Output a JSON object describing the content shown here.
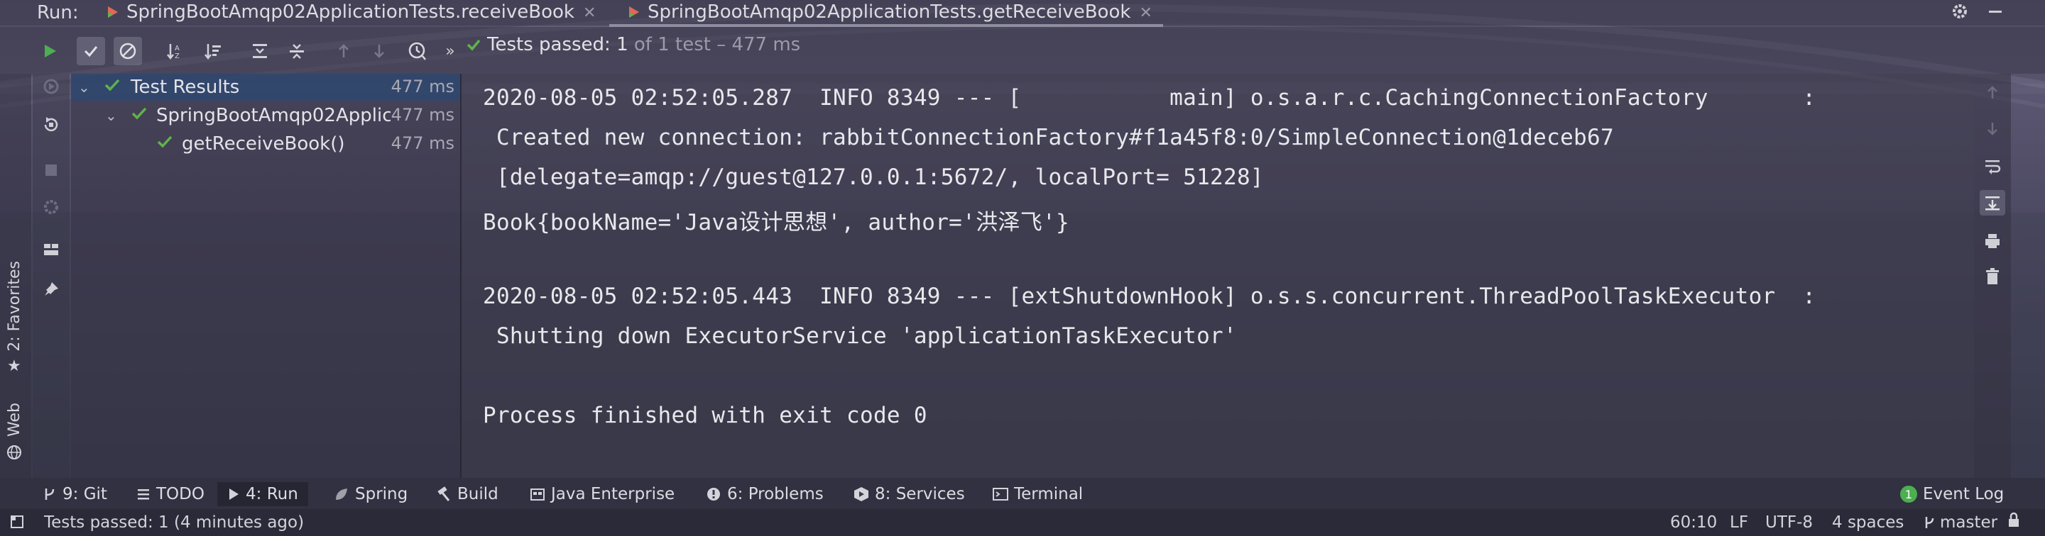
{
  "colors": {
    "accent_green": "#5fb34a",
    "run_green": "#4caf50",
    "selection": "#2f4870"
  },
  "run_bar": {
    "label": "Run:",
    "tabs": [
      {
        "title": "SpringBootAmqp02ApplicationTests.receiveBook",
        "active": false
      },
      {
        "title": "SpringBootAmqp02ApplicationTests.getReceiveBook",
        "active": true
      }
    ]
  },
  "toolbar": {
    "status_passed": "Tests passed: 1",
    "status_rest": "of 1 test – 477 ms",
    "icons": [
      "run-icon",
      "show-passed-icon",
      "show-ignored-icon",
      "sort-alpha-icon",
      "sort-duration-icon",
      "expand-all-icon",
      "collapse-all-icon",
      "prev-failed-icon",
      "next-failed-icon",
      "history-icon",
      "more-icon"
    ]
  },
  "left_tools": {
    "favorites": "2: Favorites",
    "web": "Web"
  },
  "tree": {
    "rows": [
      {
        "label": "Test Results",
        "time": "477 ms",
        "level": 0,
        "selected": true
      },
      {
        "label": "SpringBootAmqp02Applic",
        "time": "477 ms",
        "level": 1,
        "selected": false
      },
      {
        "label": "getReceiveBook()",
        "time": "477 ms",
        "level": 2,
        "selected": false
      }
    ]
  },
  "console": {
    "lines": [
      "2020-08-05 02:52:05.287  INFO 8349 --- [           main] o.s.a.r.c.CachingConnectionFactory       :",
      " Created new connection: rabbitConnectionFactory#f1a45f8:0/SimpleConnection@1deceb67",
      " [delegate=amqp://guest@127.0.0.1:5672/, localPort= 51228]",
      "Book{bookName='Java设计思想', author='洪泽飞'}",
      "",
      "2020-08-05 02:52:05.443  INFO 8349 --- [extShutdownHook] o.s.s.concurrent.ThreadPoolTaskExecutor  :",
      " Shutting down ExecutorService 'applicationTaskExecutor'",
      "",
      "Process finished with exit code 0"
    ]
  },
  "tool_windows": {
    "git": "9: Git",
    "todo": "TODO",
    "run": "4: Run",
    "spring": "Spring",
    "build": "Build",
    "java_enterprise": "Java Enterprise",
    "problems": "6: Problems",
    "services": "8: Services",
    "terminal": "Terminal",
    "event_log": "Event Log",
    "event_log_count": "1"
  },
  "status_bar": {
    "message": "Tests passed: 1 (4 minutes ago)",
    "position": "60:10",
    "line_sep": "LF",
    "encoding": "UTF-8",
    "indent": "4 spaces",
    "branch": "master"
  }
}
